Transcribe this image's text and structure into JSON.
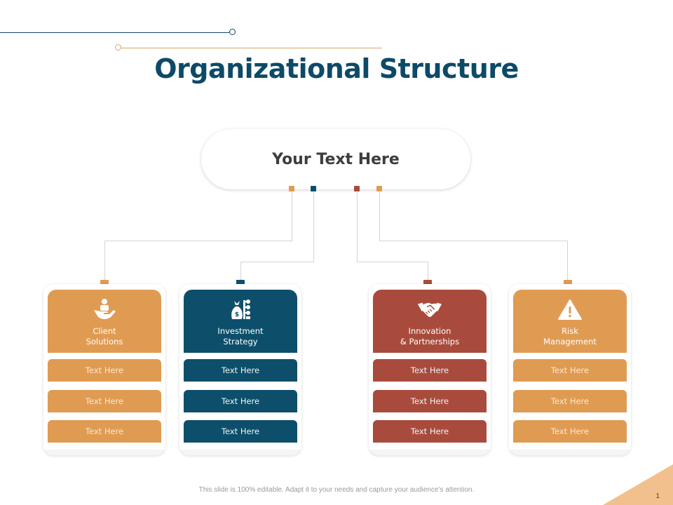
{
  "title": "Organizational Structure",
  "root": {
    "label": "Your Text Here"
  },
  "colors": {
    "gold": "#e09b52",
    "blue": "#0d4f6b",
    "red": "#a94b3c",
    "title": "#0d4a67",
    "corner": "#f1c08c"
  },
  "branches": [
    {
      "label": "Client\nSolutions",
      "icon": "hand-holding-user-icon",
      "color": "#e09b52",
      "items": [
        "Text Here",
        "Text Here",
        "Text Here"
      ]
    },
    {
      "label": "Investment\nStrategy",
      "icon": "money-bag-hierarchy-icon",
      "color": "#0d4f6b",
      "items": [
        "Text Here",
        "Text Here",
        "Text Here"
      ]
    },
    {
      "label": "Innovation\n& Partnerships",
      "icon": "handshake-icon",
      "color": "#a94b3c",
      "items": [
        "Text Here",
        "Text Here",
        "Text Here"
      ]
    },
    {
      "label": "Risk\nManagement",
      "icon": "warning-triangle-icon",
      "color": "#e09b52",
      "items": [
        "Text Here",
        "Text Here",
        "Text Here"
      ]
    }
  ],
  "footer": "This slide is 100% editable. Adapt it to your needs and capture your audience's attention.",
  "page_number": "1"
}
